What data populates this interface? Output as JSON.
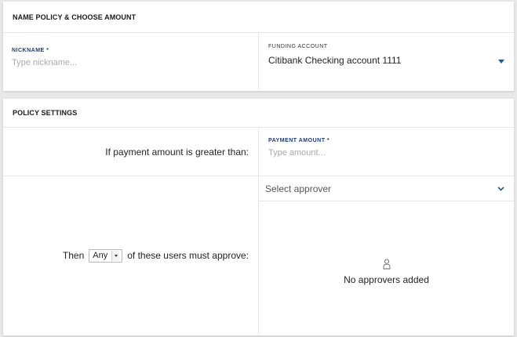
{
  "section1": {
    "header": "NAME POLICY & CHOOSE AMOUNT",
    "nickname_label": "NICKNAME *",
    "nickname_placeholder": "Type nickname...",
    "funding_label": "FUNDING ACCOUNT",
    "funding_value": "Citibank Checking account 1111"
  },
  "section2": {
    "header": "POLICY SETTINGS",
    "condition_text": "If payment amount is greater than:",
    "payment_label": "PAYMENT AMOUNT *",
    "payment_placeholder": "Type amount...",
    "then_text": "Then",
    "quorum_value": "Any",
    "approve_text": "of these users must approve:",
    "approver_placeholder": "Select approver",
    "empty_text": "No approvers added"
  },
  "icons": {
    "funding_dropdown": "caret-down-icon",
    "approver_dropdown": "chevron-down-icon",
    "empty_state": "user-outline-icon",
    "quorum_dropdown": "small-caret-icon"
  },
  "colors": {
    "accent": "#1f5a99",
    "label_blue": "#1a3a8a",
    "background": "#e9e9ea",
    "card": "#ffffff"
  }
}
